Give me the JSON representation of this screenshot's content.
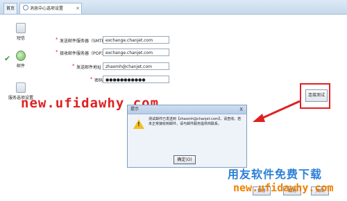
{
  "tabs": [
    {
      "label": "首页"
    },
    {
      "label": "消息中心选项设置"
    }
  ],
  "sidebar": {
    "items": [
      {
        "label": "短信",
        "icon": "sms-icon"
      },
      {
        "label": "邮件",
        "icon": "mail-icon"
      },
      {
        "label": "服务选项设置",
        "icon": "settings-icon"
      }
    ]
  },
  "form": {
    "fields": [
      {
        "label": "发送邮件服务器（SMTP）",
        "value": "exchange.chanjet.com"
      },
      {
        "label": "接收邮件服务器（POP3）",
        "value": "exchange.chanjet.com"
      },
      {
        "label": "发送邮件地址",
        "value": "zhaomh@chanjet.com"
      },
      {
        "label": "密码",
        "value": "●●●●●●●●●●●"
      }
    ],
    "test_button": "连接测试"
  },
  "dialog": {
    "title": "提示",
    "close": "X",
    "message": "测试邮件已发送到【zhaomh@chanjet.com】，请查收。若未正常接收到邮件，请与邮件服务提供商联系。",
    "ok_button": "确定(O)"
  },
  "bottom_buttons": [
    "保存",
    "取消",
    "关闭"
  ],
  "watermarks": {
    "site1": "new.ufidawhy.com",
    "brand": "用友软件免费下载",
    "site2": "new.ufidawhy.com"
  },
  "colors": {
    "accent_red": "#e02020",
    "brand_blue": "#2c7fd6",
    "watermark_orange": "#f08000"
  }
}
